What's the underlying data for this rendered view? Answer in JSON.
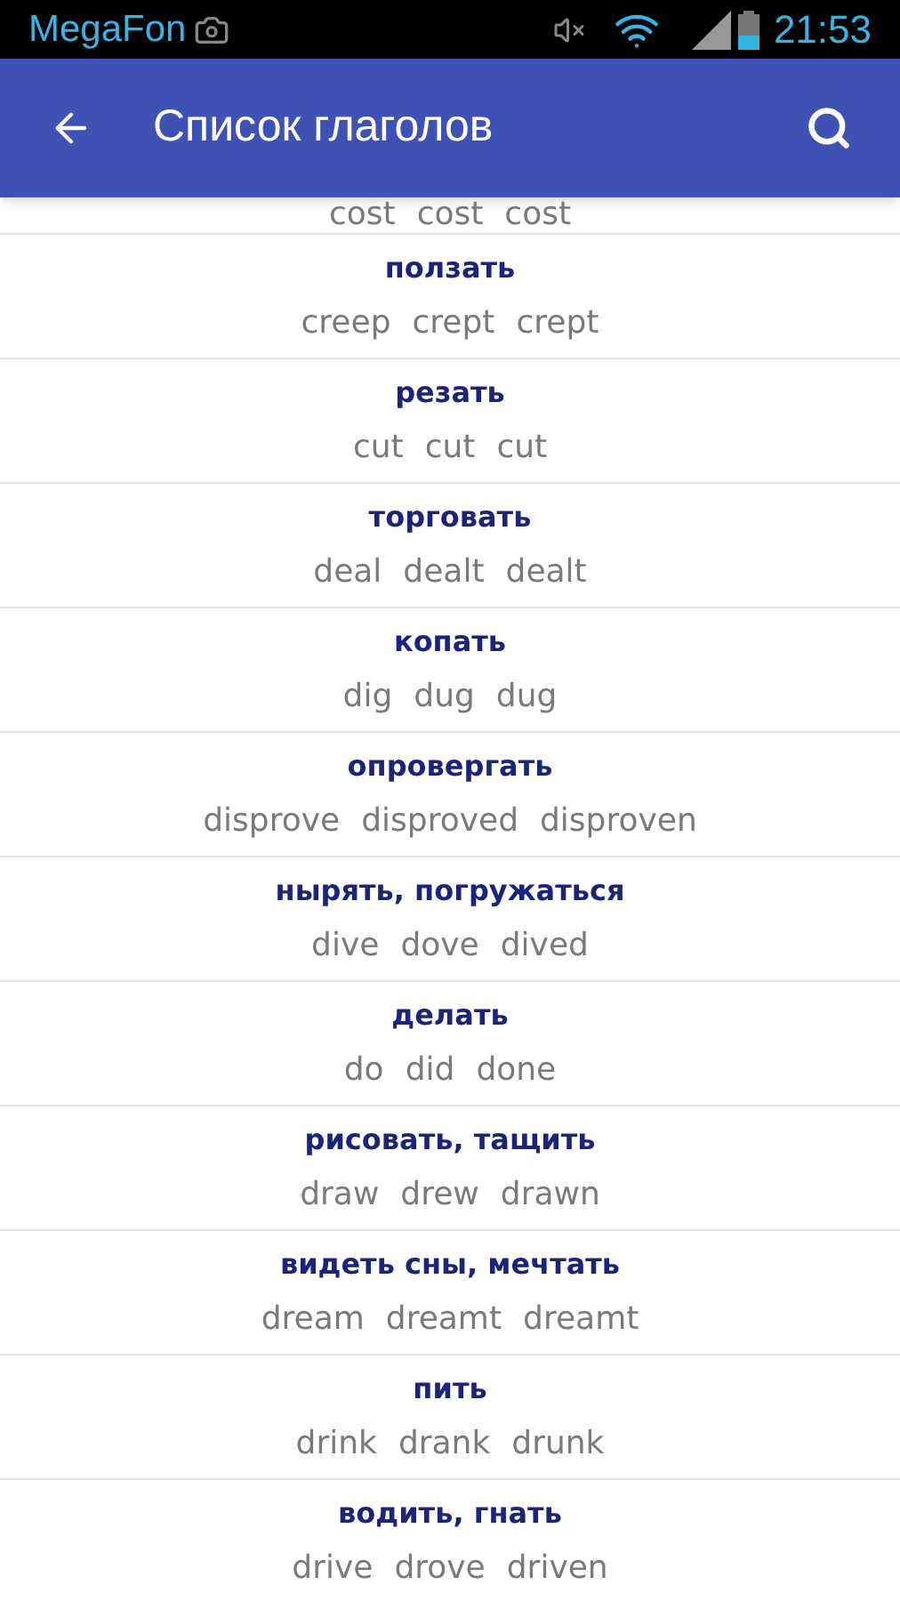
{
  "status_bar": {
    "carrier": "MegaFon",
    "time": "21:53"
  },
  "app_bar": {
    "title": "Список глаголов"
  },
  "partial_row": {
    "forms": [
      "cost",
      "cost",
      "cost"
    ]
  },
  "verbs": [
    {
      "translation": "ползать",
      "forms": [
        "creep",
        "crept",
        "crept"
      ]
    },
    {
      "translation": "резать",
      "forms": [
        "cut",
        "cut",
        "cut"
      ]
    },
    {
      "translation": "торговать",
      "forms": [
        "deal",
        "dealt",
        "dealt"
      ]
    },
    {
      "translation": "копать",
      "forms": [
        "dig",
        "dug",
        "dug"
      ]
    },
    {
      "translation": "опровергать",
      "forms": [
        "disprove",
        "disproved",
        "disproven"
      ]
    },
    {
      "translation": "нырять, погружаться",
      "forms": [
        "dive",
        "dove",
        "dived"
      ]
    },
    {
      "translation": "делать",
      "forms": [
        "do",
        "did",
        "done"
      ]
    },
    {
      "translation": "рисовать, тащить",
      "forms": [
        "draw",
        "drew",
        "drawn"
      ]
    },
    {
      "translation": "видеть сны, мечтать",
      "forms": [
        "dream",
        "dreamt",
        "dreamt"
      ]
    },
    {
      "translation": "пить",
      "forms": [
        "drink",
        "drank",
        "drunk"
      ]
    },
    {
      "translation": "водить, гнать",
      "forms": [
        "drive",
        "drove",
        "driven"
      ]
    }
  ]
}
